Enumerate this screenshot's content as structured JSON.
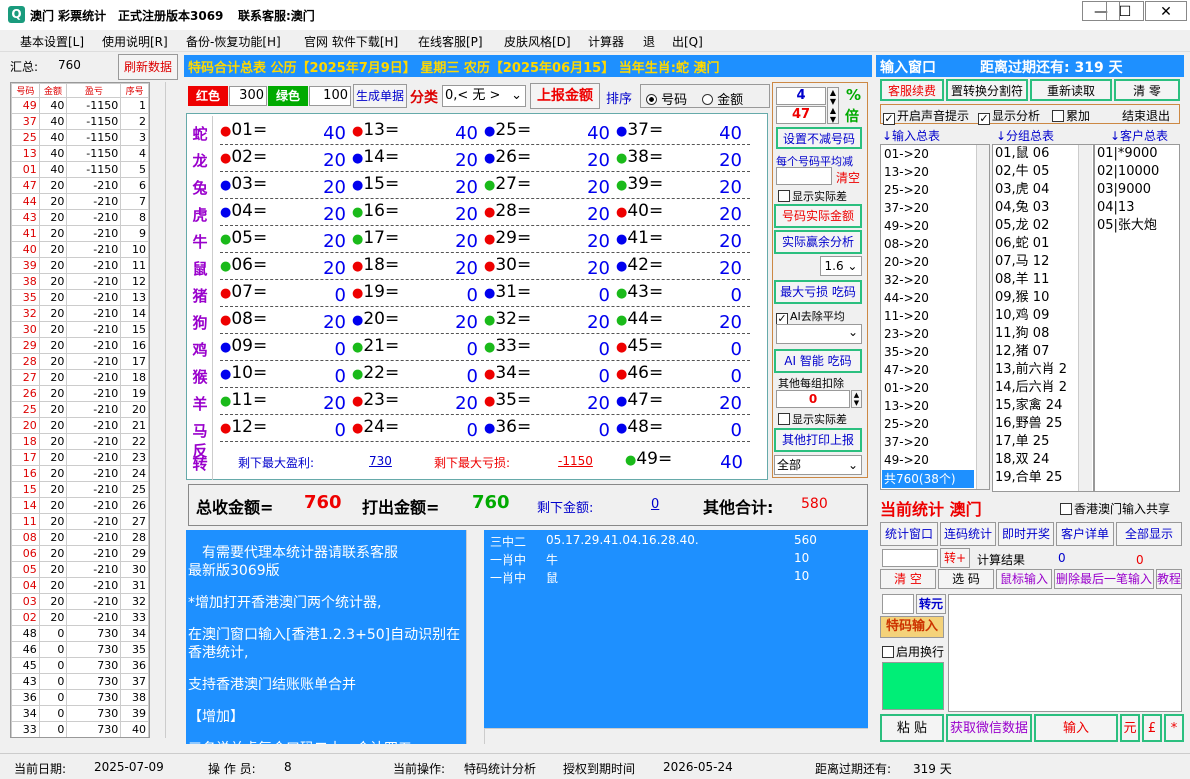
{
  "title": {
    "app": "澳门 彩票统计",
    "version": "正式注册版本3069",
    "contact": "联系客服:澳门"
  },
  "menus": [
    "基本设置[L]",
    "使用说明[R]",
    "备份-恢复功能[H]",
    "官网 软件下载[H]",
    "在线客服[P]",
    "皮肤风格[D]",
    "计算器",
    "退",
    "出[Q]"
  ],
  "left": {
    "total_label": "汇总:",
    "total_value": "760",
    "refresh": "刷新数据",
    "headers": [
      "号码",
      "金额",
      "盈亏",
      "序号"
    ],
    "rows": [
      [
        "49",
        "40",
        "-1150",
        "1"
      ],
      [
        "37",
        "40",
        "-1150",
        "2"
      ],
      [
        "25",
        "40",
        "-1150",
        "3"
      ],
      [
        "13",
        "40",
        "-1150",
        "4"
      ],
      [
        "01",
        "40",
        "-1150",
        "5"
      ],
      [
        "47",
        "20",
        "-210",
        "6"
      ],
      [
        "44",
        "20",
        "-210",
        "7"
      ],
      [
        "43",
        "20",
        "-210",
        "8"
      ],
      [
        "41",
        "20",
        "-210",
        "9"
      ],
      [
        "40",
        "20",
        "-210",
        "10"
      ],
      [
        "39",
        "20",
        "-210",
        "11"
      ],
      [
        "38",
        "20",
        "-210",
        "12"
      ],
      [
        "35",
        "20",
        "-210",
        "13"
      ],
      [
        "32",
        "20",
        "-210",
        "14"
      ],
      [
        "30",
        "20",
        "-210",
        "15"
      ],
      [
        "29",
        "20",
        "-210",
        "16"
      ],
      [
        "28",
        "20",
        "-210",
        "17"
      ],
      [
        "27",
        "20",
        "-210",
        "18"
      ],
      [
        "26",
        "20",
        "-210",
        "19"
      ],
      [
        "25",
        "20",
        "-210",
        "20"
      ],
      [
        "20",
        "20",
        "-210",
        "21"
      ],
      [
        "18",
        "20",
        "-210",
        "22"
      ],
      [
        "17",
        "20",
        "-210",
        "23"
      ],
      [
        "16",
        "20",
        "-210",
        "24"
      ],
      [
        "15",
        "20",
        "-210",
        "25"
      ],
      [
        "14",
        "20",
        "-210",
        "26"
      ],
      [
        "11",
        "20",
        "-210",
        "27"
      ],
      [
        "08",
        "20",
        "-210",
        "28"
      ],
      [
        "06",
        "20",
        "-210",
        "29"
      ],
      [
        "05",
        "20",
        "-210",
        "30"
      ],
      [
        "04",
        "20",
        "-210",
        "31"
      ],
      [
        "03",
        "20",
        "-210",
        "32"
      ],
      [
        "02",
        "20",
        "-210",
        "33"
      ],
      [
        "48",
        "0",
        "730",
        "34"
      ],
      [
        "46",
        "0",
        "730",
        "35"
      ],
      [
        "45",
        "0",
        "730",
        "36"
      ],
      [
        "43",
        "0",
        "730",
        "37"
      ],
      [
        "36",
        "0",
        "730",
        "38"
      ],
      [
        "34",
        "0",
        "730",
        "39"
      ],
      [
        "33",
        "0",
        "730",
        "40"
      ]
    ]
  },
  "header": {
    "line": "特码合计总表  公历【2025年7月9日】  星期三  农历【2025年06月15】  当年生肖:蛇  澳门"
  },
  "controls": {
    "red_label": "红色",
    "red_val": "300",
    "green_label": "绿色",
    "green_val": "100",
    "gen_single": "生成单据",
    "classify": "分类",
    "select": "0,< 无 >",
    "report": "上报金额",
    "sort": "排序",
    "radio1": "号码",
    "radio2": "金额"
  },
  "zodiacs": [
    "蛇",
    "龙",
    "兔",
    "虎",
    "牛",
    "鼠",
    "猪",
    "狗",
    "鸡",
    "猴",
    "羊",
    "马",
    "反",
    "转"
  ],
  "grid": [
    [
      [
        "red",
        "01",
        "40"
      ],
      [
        "red",
        "13",
        "40"
      ],
      [
        "blue",
        "25",
        "40"
      ],
      [
        "blue",
        "37",
        "40"
      ]
    ],
    [
      [
        "red",
        "02",
        "20"
      ],
      [
        "blue",
        "14",
        "20"
      ],
      [
        "blue",
        "26",
        "20"
      ],
      [
        "green",
        "38",
        "20"
      ]
    ],
    [
      [
        "blue",
        "03",
        "20"
      ],
      [
        "blue",
        "15",
        "20"
      ],
      [
        "green",
        "27",
        "20"
      ],
      [
        "green",
        "39",
        "20"
      ]
    ],
    [
      [
        "blue",
        "04",
        "20"
      ],
      [
        "green",
        "16",
        "20"
      ],
      [
        "red",
        "28",
        "20"
      ],
      [
        "red",
        "40",
        "20"
      ]
    ],
    [
      [
        "green",
        "05",
        "20"
      ],
      [
        "green",
        "17",
        "20"
      ],
      [
        "red",
        "29",
        "20"
      ],
      [
        "blue",
        "41",
        "20"
      ]
    ],
    [
      [
        "green",
        "06",
        "20"
      ],
      [
        "red",
        "18",
        "20"
      ],
      [
        "red",
        "30",
        "20"
      ],
      [
        "blue",
        "42",
        "20"
      ]
    ],
    [
      [
        "red",
        "07",
        "0"
      ],
      [
        "red",
        "19",
        "0"
      ],
      [
        "blue",
        "31",
        "0"
      ],
      [
        "green",
        "43",
        "0"
      ]
    ],
    [
      [
        "red",
        "08",
        "20"
      ],
      [
        "blue",
        "20",
        "20"
      ],
      [
        "green",
        "32",
        "20"
      ],
      [
        "green",
        "44",
        "20"
      ]
    ],
    [
      [
        "blue",
        "09",
        "0"
      ],
      [
        "green",
        "21",
        "0"
      ],
      [
        "green",
        "33",
        "0"
      ],
      [
        "red",
        "45",
        "0"
      ]
    ],
    [
      [
        "blue",
        "10",
        "0"
      ],
      [
        "green",
        "22",
        "0"
      ],
      [
        "red",
        "34",
        "0"
      ],
      [
        "red",
        "46",
        "0"
      ]
    ],
    [
      [
        "green",
        "11",
        "20"
      ],
      [
        "red",
        "23",
        "20"
      ],
      [
        "red",
        "35",
        "20"
      ],
      [
        "blue",
        "47",
        "20"
      ]
    ],
    [
      [
        "red",
        "12",
        "0"
      ],
      [
        "red",
        "24",
        "0"
      ],
      [
        "blue",
        "36",
        "0"
      ],
      [
        "blue",
        "48",
        "0"
      ]
    ]
  ],
  "grid_last": [
    "green",
    "49",
    "40"
  ],
  "profit": {
    "max_win_label": "剩下最大盈利:",
    "max_win": "730",
    "max_loss_label": "剩下最大亏损:",
    "max_loss": "-1150"
  },
  "mid": {
    "spin1": "4",
    "spin2": "47",
    "pct": "%",
    "bei": "倍",
    "btn1": "设置不减号码",
    "avg_label": "每个号码平均减",
    "clear": "清空",
    "show_real": "显示实际差",
    "btn2": "号码实际金额",
    "btn3": "实际赢余分析",
    "ratio": "1.6",
    "btn4": "最大亏损 吃码",
    "ai_avg": "AI去除平均",
    "btn5": "AI 智能 吃码",
    "other_deduct": "其他每组扣除",
    "other_val": "0",
    "show_real2": "显示实际差",
    "btn6": "其他打印上报",
    "all": "全部"
  },
  "totals": {
    "total_label": "总收金额=",
    "total": "760",
    "out_label": "打出金额=",
    "out": "760",
    "remain_label": "剩下金额:",
    "remain": "0",
    "other_label": "其他合计:",
    "other": "580"
  },
  "notice": [
    "有需要代理本统计器请联系客服",
    "最新版3069版",
    "*增加打开香港澳门两个统计器,",
    "在澳门窗口输入[香港1.2.3+50]自动识别在香港统计,",
    "支持香港澳门结账账单合并",
    "【增加】",
    "三名说关虚复合口码二十一合计四五"
  ],
  "results": [
    [
      "三中二",
      "05.17.29.41.04.16.28.40.",
      "560"
    ],
    [
      "一肖中",
      "牛",
      "10"
    ],
    [
      "一肖中",
      "鼠",
      "10"
    ]
  ],
  "right": {
    "window": "输入窗口",
    "expire": "距离过期还有: 319 天",
    "b1": "客服续费",
    "b2": "置转换分割符",
    "b3": "重新读取",
    "b4": "清 零",
    "c1": "开启声音提示",
    "c2": "显示分析",
    "c3": "累加",
    "exit": "结束退出",
    "h1": "↓输入总表",
    "h2": "↓分组总表",
    "h3": "↓客户总表",
    "inputs": [
      "01->20",
      "13->20",
      "25->20",
      "37->20",
      "49->20",
      "08->20",
      "20->20",
      "32->20",
      "44->20",
      "11->20",
      "23->20",
      "35->20",
      "47->20",
      "01->20",
      "13->20",
      "25->20",
      "37->20",
      "49->20"
    ],
    "input_total": "共760(38个)",
    "groups": [
      "01,鼠 06",
      "02,牛 05",
      "03,虎 04",
      "04,兔 03",
      "05,龙 02",
      "06,蛇 01",
      "07,马 12",
      "08,羊 11",
      "09,猴 10",
      "10,鸡 09",
      "11,狗 08",
      "12,猪 07",
      "13,前六肖 2",
      "14,后六肖 2",
      "15,家禽 24",
      "16,野兽 25",
      "17,单 25",
      "18,双 24",
      "19,合单 25"
    ],
    "customers": [
      "01|*9000",
      "02|10000",
      "03|9000",
      "04|13",
      "05|张大炮"
    ],
    "current": "当前统计 澳门",
    "share": "香港澳门输入共享",
    "tabs": [
      "统计窗口",
      "连码统计",
      "即时开奖",
      "客户详单",
      "全部显示"
    ],
    "turn": "转+",
    "calc_label": "计算结果",
    "calc1": "0",
    "calc2": "0",
    "tabs2": [
      "清 空",
      "选 码",
      "鼠标输入",
      "删除最后一笔输入",
      "教程"
    ],
    "zhuan": "转元",
    "tema": "特码输入",
    "enable_wrap": "启用换行",
    "bottom": [
      "粘 贴",
      "获取微信数据",
      "输入",
      "元",
      "£",
      "*"
    ]
  },
  "status": {
    "date_label": "当前日期:",
    "date": "2025-07-09",
    "op_label": "操 作 员:",
    "op": "8",
    "cur_label": "当前操作:",
    "cur": "特码统计分析",
    "auth_label": "授权到期时间",
    "auth": "2026-05-24",
    "exp_label": "距离过期还有:",
    "exp": "319 天"
  }
}
